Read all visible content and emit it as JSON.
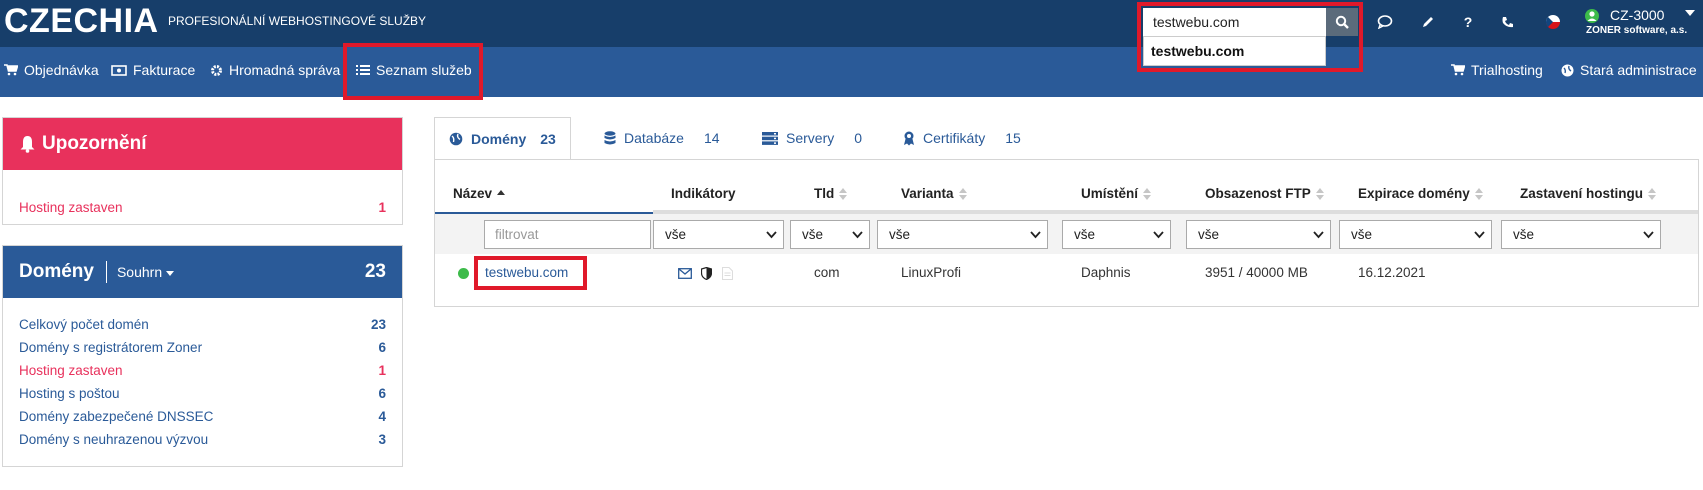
{
  "header": {
    "brand": "CZECHIA",
    "tagline": "PROFESIONÁLNÍ WEBHOSTINGOVÉ SLUŽBY",
    "search_value": "testwebu.com",
    "suggestion": "testwebu.com",
    "account_code": "CZ-3000",
    "account_name": "ZONER software, a.s."
  },
  "nav": {
    "left": [
      "Objednávka",
      "Fakturace",
      "Hromadná správa",
      "Seznam služeb"
    ],
    "right": [
      "Trialhosting",
      "Stará administrace"
    ]
  },
  "alerts": {
    "title": "Upozornění",
    "items": [
      {
        "label": "Hosting zastaven",
        "count": "1"
      }
    ]
  },
  "domains_panel": {
    "title": "Domény",
    "dropdown": "Souhrn",
    "total": "23",
    "items": [
      {
        "label": "Celkový počet domén",
        "count": "23"
      },
      {
        "label": "Domény s registrátorem Zoner",
        "count": "6"
      },
      {
        "label": "Hosting zastaven",
        "count": "1"
      },
      {
        "label": "Hosting s poštou",
        "count": "6"
      },
      {
        "label": "Domény zabezpečené DNSSEC",
        "count": "4"
      },
      {
        "label": "Domény s neuhrazenou výzvou",
        "count": "3"
      }
    ]
  },
  "tabs": [
    {
      "label": "Domény",
      "count": "23"
    },
    {
      "label": "Databáze",
      "count": "14"
    },
    {
      "label": "Servery",
      "count": "0"
    },
    {
      "label": "Certifikáty",
      "count": "15"
    }
  ],
  "table": {
    "columns": [
      "Název",
      "Indikátory",
      "Tld",
      "Varianta",
      "Umístění",
      "Obsazenost FTP",
      "Expirace domény",
      "Zastavení hostingu"
    ],
    "filter_placeholder": "filtrovat",
    "filter_option": "vše",
    "rows": [
      {
        "name": "testwebu.com",
        "tld": "com",
        "variant": "LinuxProfi",
        "location": "Daphnis",
        "ftp": "3951 / 40000 MB",
        "expiry": "16.12.2021",
        "stop": ""
      }
    ]
  },
  "colors": {
    "topbar": "#173e6a",
    "navbar": "#2a5a98",
    "alert": "#e8315c",
    "highlight": "#e0192a",
    "status_active": "#3dbb4a"
  }
}
